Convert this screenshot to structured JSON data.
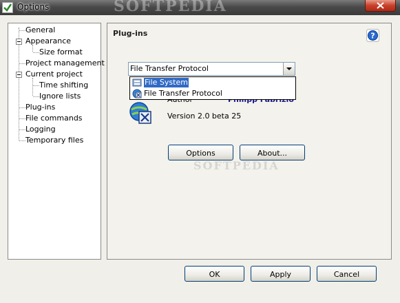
{
  "window": {
    "title": "Options",
    "watermark": "SOFTPEDIA"
  },
  "tree": {
    "items": [
      {
        "label": "General"
      },
      {
        "label": "Appearance"
      },
      {
        "label": "Size format"
      },
      {
        "label": "Project management"
      },
      {
        "label": "Current project"
      },
      {
        "label": "Time shifting"
      },
      {
        "label": "Ignore lists"
      },
      {
        "label": "Plug-ins"
      },
      {
        "label": "File commands"
      },
      {
        "label": "Logging"
      },
      {
        "label": "Temporary files"
      }
    ]
  },
  "panel": {
    "title": "Plug-ins",
    "combo_value": "File Transfer Protocol",
    "dropdown_options": [
      "File System",
      "File Transfer Protocol"
    ],
    "dropdown_selected": "File System",
    "author_label": "Author",
    "author_value": "Philipp Fabrizio",
    "version": "Version 2.0 beta 25",
    "options_button": "Options",
    "about_button": "About..."
  },
  "footer": {
    "ok": "OK",
    "apply": "Apply",
    "cancel": "Cancel"
  },
  "colors": {
    "selection": "#316ac5",
    "author_link": "#1a1a8c",
    "close_button": "#c8402a"
  }
}
